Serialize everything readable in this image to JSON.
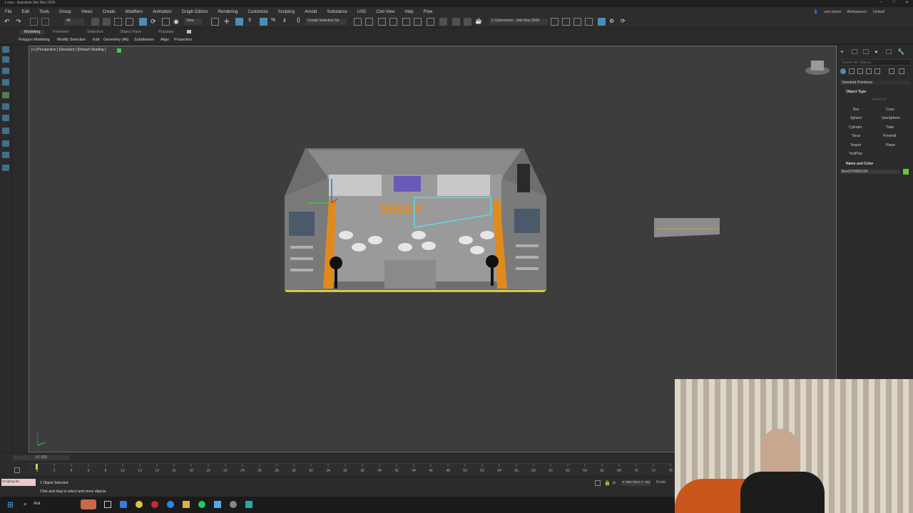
{
  "window": {
    "title": "1.max - Autodesk 3ds Max 2026"
  },
  "menubar": {
    "items": [
      "File",
      "Edit",
      "Tools",
      "Group",
      "Views",
      "Create",
      "Modifiers",
      "Animation",
      "Graph Editors",
      "Rendering",
      "Customize",
      "Scripting",
      "Arnold",
      "Substance",
      "USD",
      "Civil View",
      "Help",
      "Flow"
    ],
    "user": "cem işmen",
    "workspaces_label": "Workspaces:",
    "workspace": "Default"
  },
  "toolbar": {
    "selection_filter": "All",
    "view_dropdown": "View",
    "create_selection_set": "Create Selection Se",
    "path": "C:\\Users\\cem...\\3ds Max 2026"
  },
  "ribbon": {
    "tabs": [
      "Modeling",
      "Freeform",
      "Selection",
      "Object Paint",
      "Populate"
    ],
    "active_tab": "Modeling",
    "subtabs": [
      "Polygon Modeling",
      "Modify Selection",
      "Edit",
      "Geometry (All)",
      "Subdivision",
      "Align",
      "Properties"
    ]
  },
  "viewport": {
    "label": "[+] [Perspective ] [Standard ] [Default Shading ]",
    "booth_logo": "SIBAX"
  },
  "command_panel": {
    "search_placeholder": "Search All Objects...",
    "category": "Standard Primitives",
    "object_type_header": "Object Type",
    "autogrid": "AutoGrid",
    "primitives": [
      "Box",
      "Cone",
      "Sphere",
      "GeoSphere",
      "Cylinder",
      "Tube",
      "Torus",
      "Pyramid",
      "Teapot",
      "Plane",
      "TextPlus"
    ],
    "name_color_header": "Name and Color",
    "object_name": "Box1578962100"
  },
  "timeline": {
    "frame": "0 / 100",
    "ticks": [
      "0",
      "2",
      "4",
      "6",
      "8",
      "10",
      "12",
      "14",
      "16",
      "18",
      "20",
      "22",
      "24",
      "26",
      "28",
      "30",
      "32",
      "34",
      "36",
      "38",
      "40",
      "42",
      "44",
      "46",
      "48",
      "50",
      "52",
      "54",
      "56",
      "58",
      "60",
      "62",
      "64",
      "66",
      "68",
      "70",
      "72",
      "74"
    ]
  },
  "status": {
    "selection": "1 Object Selected",
    "hint": "Click and drag to select and move objects",
    "maxscript": "Scripting Mi",
    "coords": "X: 589,761m  Y: 161,526m",
    "enable": "Enabl"
  },
  "taskbar": {
    "search_label": "Ara"
  },
  "colors": {
    "accent": "#4a8fb3",
    "selection_cyan": "#4fe6f0",
    "booth_orange": "#e08a1e",
    "viewport_bg": "#3d3d3d"
  }
}
